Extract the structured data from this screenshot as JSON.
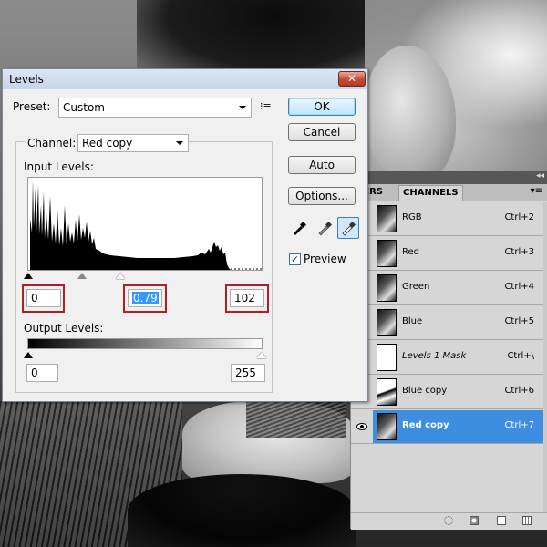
{
  "levels": {
    "title": "Levels",
    "close_glyph": "✕",
    "preset_label": "Preset:",
    "preset_value": "Custom",
    "channel_label": "Channel:",
    "channel_value": "Red copy",
    "input_levels_label": "Input Levels:",
    "input_black": "0",
    "input_gamma": "0.79",
    "input_white": "102",
    "output_levels_label": "Output Levels:",
    "output_black": "0",
    "output_white": "255",
    "ok_label": "OK",
    "cancel_label": "Cancel",
    "auto_label": "Auto",
    "options_label": "Options...",
    "preview_label": "Preview",
    "preview_checked": true,
    "highlight_color": "#b01f24",
    "icons": {
      "preset_menu": "preset-options-icon",
      "black_eyedropper": "black-eyedropper-icon",
      "gray_eyedropper": "gray-eyedropper-icon",
      "white_eyedropper": "white-eyedropper-icon"
    }
  },
  "channels_panel": {
    "tabs": [
      "YERS",
      "CHANNELS"
    ],
    "active_tab": "CHANNELS",
    "selection_color": "#3d8de1",
    "rows": [
      {
        "name": "RGB",
        "shortcut": "Ctrl+2",
        "thumb": "photo",
        "visible": false,
        "selected": false
      },
      {
        "name": "Red",
        "shortcut": "Ctrl+3",
        "thumb": "photo",
        "visible": false,
        "selected": false
      },
      {
        "name": "Green",
        "shortcut": "Ctrl+4",
        "thumb": "photo",
        "visible": false,
        "selected": false
      },
      {
        "name": "Blue",
        "shortcut": "Ctrl+5",
        "thumb": "photo",
        "visible": false,
        "selected": false
      },
      {
        "name": "Levels 1 Mask",
        "shortcut": "Ctrl+\\",
        "thumb": "mask",
        "visible": false,
        "selected": false
      },
      {
        "name": "Blue copy",
        "shortcut": "Ctrl+6",
        "thumb": "bw",
        "visible": false,
        "selected": false
      },
      {
        "name": "Red copy",
        "shortcut": "Ctrl+7",
        "thumb": "photo",
        "visible": true,
        "selected": true
      }
    ],
    "footer_icons": [
      "load-selection-icon",
      "save-selection-icon",
      "new-channel-icon",
      "delete-channel-icon"
    ]
  }
}
